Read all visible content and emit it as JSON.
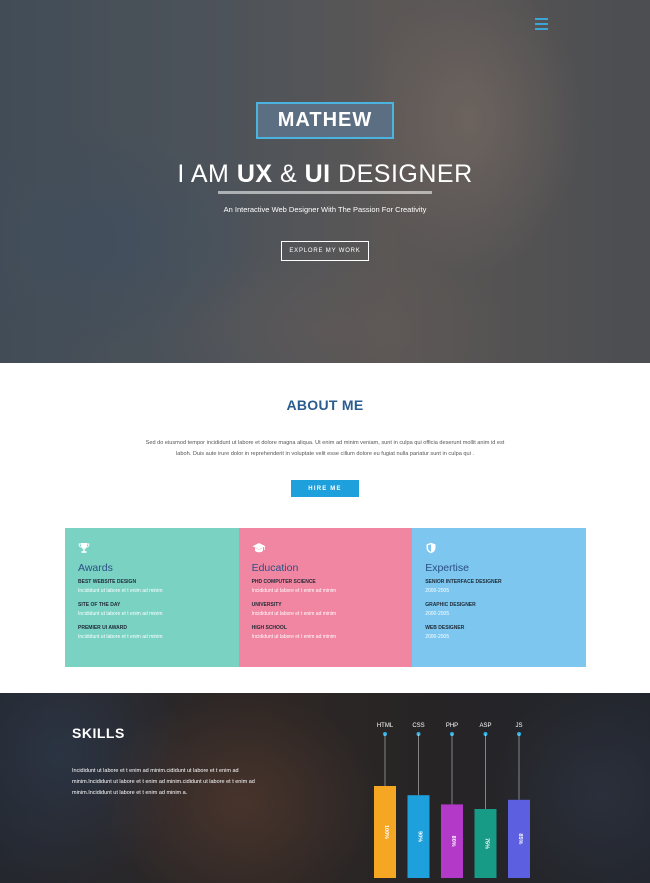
{
  "hero": {
    "name": "MATHEW",
    "headline": {
      "pre": "I AM ",
      "ux": "UX",
      "amp": " & ",
      "ui": "UI",
      "post": " DESIGNER"
    },
    "tagline": "An Interactive Web Designer With The Passion For Creativity",
    "cta_label": "EXPLORE MY WORK",
    "menu_icon": "hamburger-menu-icon"
  },
  "about": {
    "title": "ABOUT ME",
    "text_line1": "Sed do eiusmod tempor incididunt ut labore et dolore magna aliqua. Ut enim ad minim veniam, sunt in culpa qui officia deserunt mollit anim id est",
    "text_line2": "laboh. Duis aute irure dolor in reprehenderit in voluptate velit esse cillum dolore eu fugiat nulla pariatur sunt in culpa qui .",
    "hire_label": "HIRE ME"
  },
  "cards": [
    {
      "icon": "trophy-icon",
      "title": "Awards",
      "color": "#7ad2c3",
      "items": [
        {
          "title": "BEST WEBSITE DESIGN",
          "sub": "Incididunt ut labore et t enim ad minim"
        },
        {
          "title": "SITE OF THE DAY",
          "sub": "Incididunt ut labore et t enim ad minim"
        },
        {
          "title": "PREMIER UI AWARD",
          "sub": "Incididunt ut labore et t enim ad minim"
        }
      ]
    },
    {
      "icon": "graduation-cap-icon",
      "title": "Education",
      "color": "#f086a1",
      "items": [
        {
          "title": "PHD COMPUTER SCIENCE",
          "sub": "Incididunt ut labore et t enim ad minim"
        },
        {
          "title": "UNIVERSITY",
          "sub": "Incididunt ut labore et t enim ad minim"
        },
        {
          "title": "HIGH SCHOOL",
          "sub": "Incididunt ut labore et t enim ad minim"
        }
      ]
    },
    {
      "icon": "shield-icon",
      "title": "Expertise",
      "color": "#7cc6ef",
      "items": [
        {
          "title": "SENIOR INTERFACE DESIGNER",
          "sub": "2000-2005"
        },
        {
          "title": "GRAPHIC DESIGNER",
          "sub": "2000-2005"
        },
        {
          "title": "WEB DESIGNER",
          "sub": "2000-2005"
        }
      ]
    }
  ],
  "skills": {
    "title": "SKILLS",
    "text_line1": "Incididunt ut labore et t enim ad minim.cididunt ut labore et t enim ad",
    "text_line2": "minim.Incididunt ut labore et t enim ad minim.cididunt ut labore et t enim ad",
    "text_line3": "minim.Incididunt ut labore et t enim ad minim a."
  },
  "chart_data": {
    "type": "bar",
    "categories": [
      "HTML",
      "CSS",
      "PHP",
      "ASP",
      "JS"
    ],
    "values": [
      100,
      90,
      80,
      75,
      85
    ],
    "value_labels": [
      "100%",
      "90%",
      "80%",
      "75%",
      "85%"
    ],
    "colors": [
      "#f5a623",
      "#1ea0dc",
      "#b339c9",
      "#179a86",
      "#5b5fe0"
    ],
    "ylim": [
      0,
      100
    ]
  }
}
